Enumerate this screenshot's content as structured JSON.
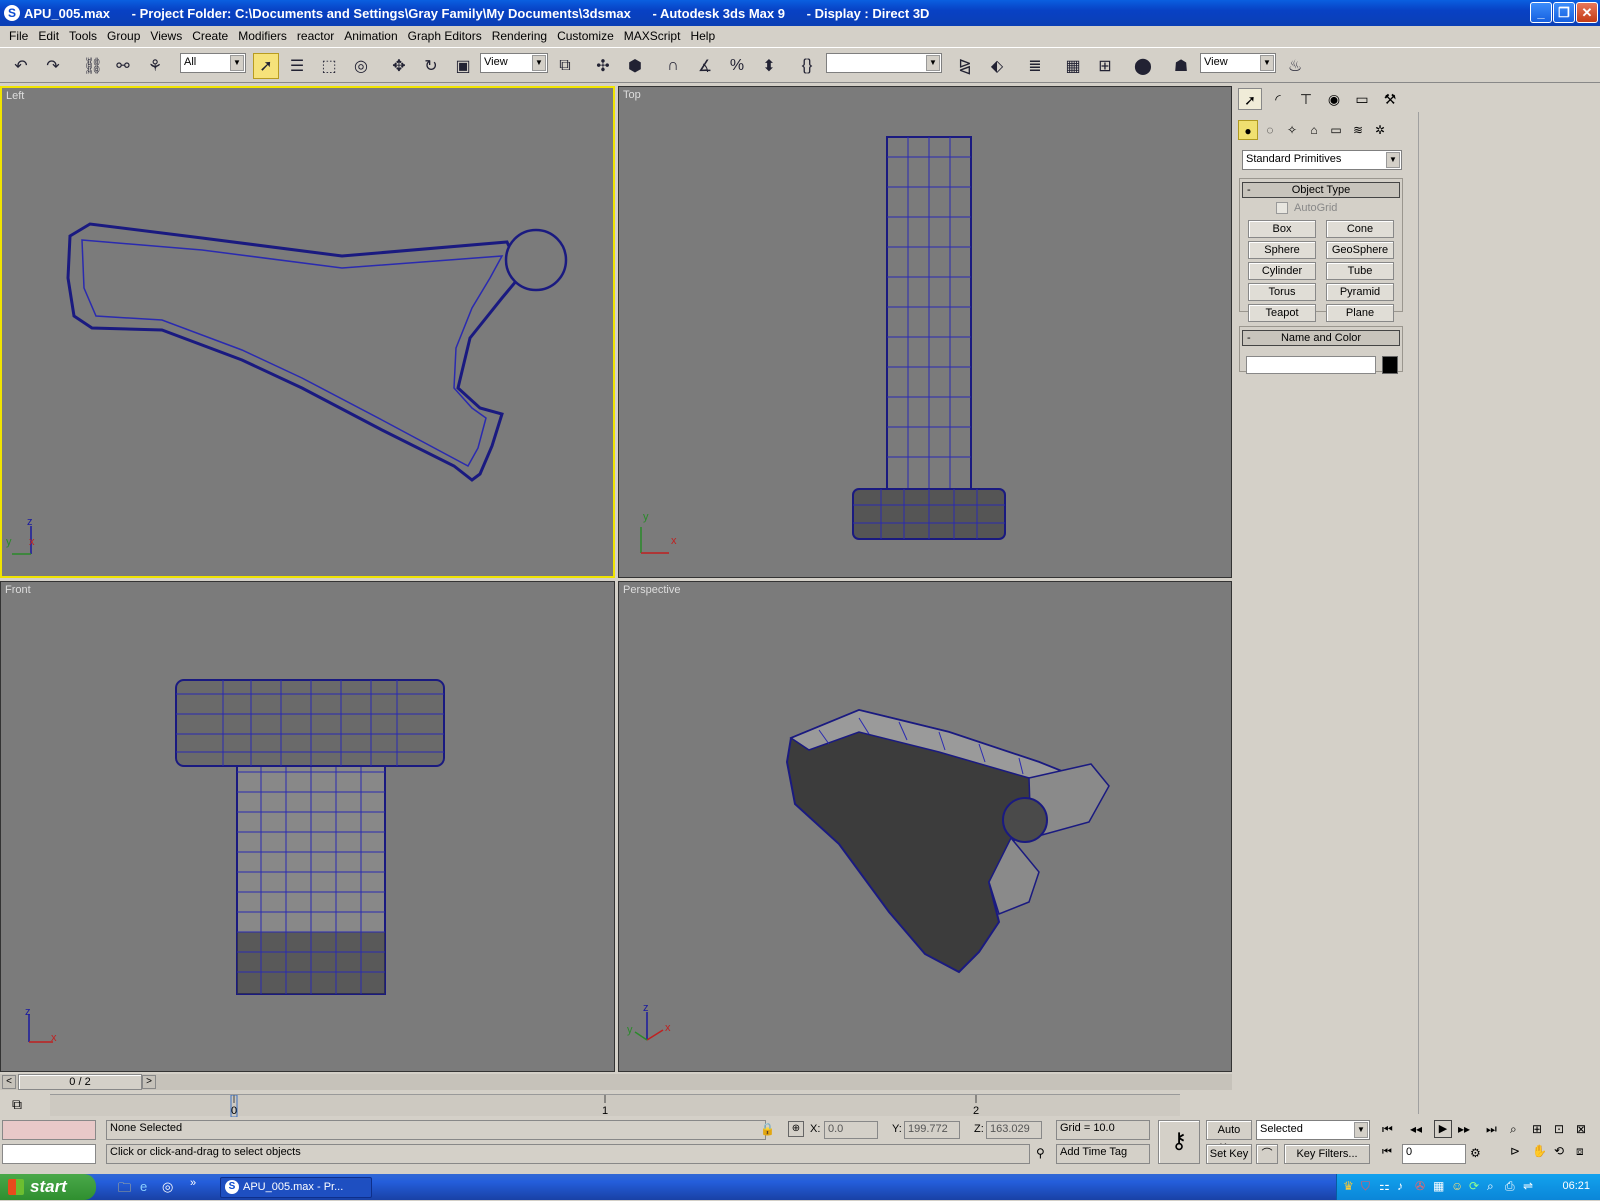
{
  "window": {
    "title": "APU_005.max      - Project Folder: C:\\Documents and Settings\\Gray Family\\My Documents\\3dsmax      - Autodesk 3ds Max 9      - Display : Direct 3D"
  },
  "menu": [
    "File",
    "Edit",
    "Tools",
    "Group",
    "Views",
    "Create",
    "Modifiers",
    "reactor",
    "Animation",
    "Graph Editors",
    "Rendering",
    "Customize",
    "MAXScript",
    "Help"
  ],
  "toolbar": {
    "selection_filter": "All",
    "coord_system": "View",
    "named_selection": "",
    "render_view": "View"
  },
  "viewports": {
    "left": {
      "label": "Left",
      "axis1": "y",
      "axis2": "z",
      "axis3": "x"
    },
    "top": {
      "label": "Top",
      "axis1": "y",
      "axis2": "x"
    },
    "front": {
      "label": "Front",
      "axis1": "z",
      "axis2": "x"
    },
    "perspective": {
      "label": "Perspective",
      "axis1": "z",
      "axis2": "x",
      "axis3": "y"
    }
  },
  "command_panel": {
    "category": "Standard Primitives",
    "object_type_header": "Object Type",
    "autogrid": "AutoGrid",
    "buttons": [
      "Box",
      "Cone",
      "Sphere",
      "GeoSphere",
      "Cylinder",
      "Tube",
      "Torus",
      "Pyramid",
      "Teapot",
      "Plane"
    ],
    "name_color_header": "Name and Color",
    "name_value": "",
    "color": "#000000",
    "minus": "-"
  },
  "timeline": {
    "slider_text": "0 / 2",
    "ticks": [
      "0",
      "1",
      "2"
    ],
    "current_frame": 0,
    "total_frames": 2
  },
  "status": {
    "selection": "None Selected",
    "prompt": "Click or click-and-drag to select objects",
    "x_label": "X:",
    "x_value": "0.0",
    "y_label": "Y:",
    "y_value": "199.772",
    "z_label": "Z:",
    "z_value": "163.029",
    "grid": "Grid = 10.0",
    "add_time_tag": "Add Time Tag",
    "auto_key": "Auto Key",
    "set_key": "Set Key",
    "key_mode": "Selected",
    "key_filters": "Key Filters...",
    "frame_value": "0"
  },
  "taskbar": {
    "start": "start",
    "app": "APU_005.max     - Pr...",
    "clock": "06:21"
  }
}
